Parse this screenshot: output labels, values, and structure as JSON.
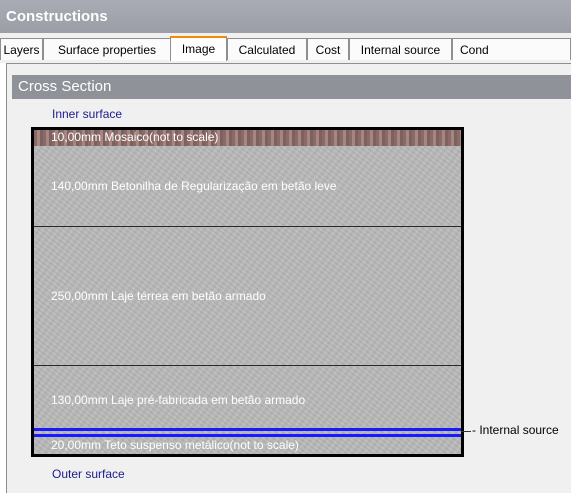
{
  "window": {
    "title": "Constructions"
  },
  "tabs": [
    {
      "label": "Layers"
    },
    {
      "label": "Surface properties"
    },
    {
      "label": "Image"
    },
    {
      "label": "Calculated"
    },
    {
      "label": "Cost"
    },
    {
      "label": "Internal source"
    },
    {
      "label": "Cond"
    }
  ],
  "active_tab": "Image",
  "section": {
    "title": "Cross Section"
  },
  "inner_surface": "Inner surface",
  "outer_surface": "Outer surface",
  "layers": [
    {
      "text": "10,00mm   Mosaico(not to scale)"
    },
    {
      "text": "140,00mm  Betonilha de Regularização em betão leve"
    },
    {
      "text": "250,00mm  Laje térrea em betão armado"
    },
    {
      "text": "130,00mm  Laje pré-fabricada em betão armado"
    },
    {
      "text": "20,00mm    Teto suspenso metálico(not to scale)"
    }
  ],
  "internal_source_label": "- Internal source",
  "colors": {
    "internal_source_line": "#1a1aff",
    "header": "#8f9299",
    "active_tab_accent": "#f08c00"
  }
}
